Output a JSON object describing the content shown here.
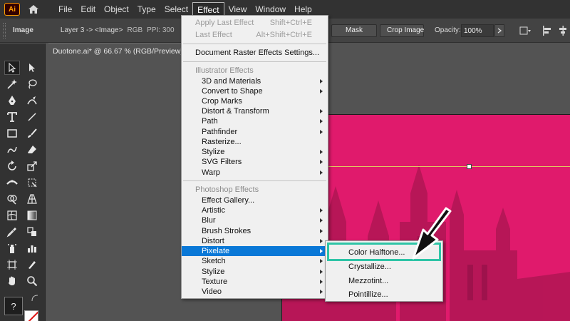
{
  "app": {
    "logo_text": "Ai"
  },
  "menubar": {
    "items": [
      "File",
      "Edit",
      "Object",
      "Type",
      "Select",
      "Effect",
      "View",
      "Window",
      "Help"
    ],
    "active": "Effect"
  },
  "controlbar": {
    "selection_type": "Image",
    "layer_info": "Layer 3 -> <Image>",
    "color_mode": "RGB",
    "ppi": "PPI: 300",
    "mask_button": "Mask",
    "crop_button": "Crop Image",
    "opacity_label": "Opacity:",
    "opacity_value": "100%"
  },
  "document": {
    "tab_title": "Duotone.ai* @ 66.67 % (RGB/Preview)",
    "image_color": "#e01a6c"
  },
  "effect_menu": {
    "apply_last": {
      "label": "Apply Last Effect",
      "shortcut": "Shift+Ctrl+E"
    },
    "last_effect": {
      "label": "Last Effect",
      "shortcut": "Alt+Shift+Ctrl+E"
    },
    "doc_raster": "Document Raster Effects Settings...",
    "illustrator_header": "Illustrator Effects",
    "illustrator_items": [
      "3D and Materials",
      "Convert to Shape",
      "Crop Marks",
      "Distort & Transform",
      "Path",
      "Pathfinder",
      "Rasterize...",
      "Stylize",
      "SVG Filters",
      "Warp"
    ],
    "photoshop_header": "Photoshop Effects",
    "photoshop_items": [
      "Effect Gallery...",
      "Artistic",
      "Blur",
      "Brush Strokes",
      "Distort",
      "Pixelate",
      "Sketch",
      "Stylize",
      "Texture",
      "Video"
    ],
    "highlighted": "Pixelate"
  },
  "pixelate_submenu": {
    "items": [
      "Color Halftone...",
      "Crystallize...",
      "Mezzotint...",
      "Pointillize..."
    ],
    "focused": "Color Halftone..."
  },
  "colors": {
    "highlight": "#0a78d7",
    "focus_box": "#2ec4a6",
    "selection_line": "#e0c860"
  }
}
